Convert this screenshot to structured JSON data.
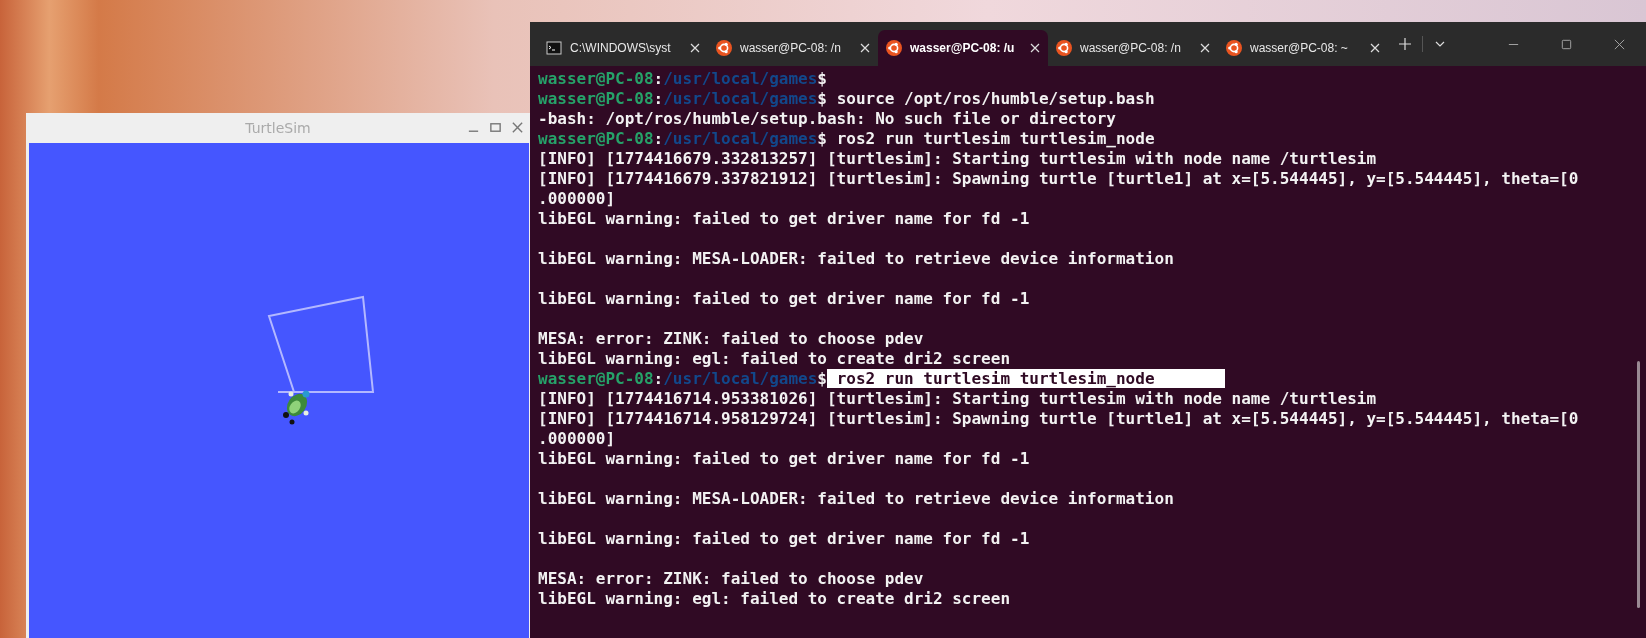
{
  "turtlesim_window": {
    "title": "TurtleSim"
  },
  "terminal": {
    "tabs": [
      {
        "kind": "cmd",
        "label": "C:\\WINDOWS\\syst",
        "selected": false
      },
      {
        "kind": "ubuntu",
        "label": "wasser@PC-08: /n",
        "selected": false
      },
      {
        "kind": "ubuntu",
        "label": "wasser@PC-08: /u",
        "selected": true
      },
      {
        "kind": "ubuntu",
        "label": "wasser@PC-08: /n",
        "selected": false
      },
      {
        "kind": "ubuntu",
        "label": "wasser@PC-08: ~",
        "selected": false
      }
    ],
    "lines": [
      {
        "kind": "prompt",
        "user": "wasser@PC-08",
        "sep": ":",
        "path": "/usr/local/games",
        "end": "$"
      },
      {
        "kind": "prompt",
        "user": "wasser@PC-08",
        "sep": ":",
        "path": "/usr/local/games",
        "end": "$",
        "command": " source /opt/ros/humble/setup.bash",
        "selected": false
      },
      {
        "kind": "output",
        "text": "-bash: /opt/ros/humble/setup.bash: No such file or directory"
      },
      {
        "kind": "prompt",
        "user": "wasser@PC-08",
        "sep": ":",
        "path": "/usr/local/games",
        "end": "$",
        "command": " ros2 run turtlesim turtlesim_node",
        "selected": false
      },
      {
        "kind": "output",
        "text": "[INFO] [1774416679.332813257] [turtlesim]: Starting turtlesim with node name /turtlesim"
      },
      {
        "kind": "output",
        "text": "[INFO] [1774416679.337821912] [turtlesim]: Spawning turtle [turtle1] at x=[5.544445], y=[5.544445], theta=[0"
      },
      {
        "kind": "output",
        "text": ".000000]"
      },
      {
        "kind": "output",
        "text": "libEGL warning: failed to get driver name for fd -1"
      },
      {
        "kind": "blank"
      },
      {
        "kind": "output",
        "text": "libEGL warning: MESA-LOADER: failed to retrieve device information"
      },
      {
        "kind": "blank"
      },
      {
        "kind": "output",
        "text": "libEGL warning: failed to get driver name for fd -1"
      },
      {
        "kind": "blank"
      },
      {
        "kind": "output",
        "text": "MESA: error: ZINK: failed to choose pdev"
      },
      {
        "kind": "output",
        "text": "libEGL warning: egl: failed to create dri2 screen"
      },
      {
        "kind": "prompt",
        "user": "wasser@PC-08",
        "sep": ":",
        "path": "/usr/local/games",
        "end": "$",
        "command": " ros2 run turtlesim turtlesim_node",
        "selected": true
      },
      {
        "kind": "output",
        "text": "[INFO] [1774416714.953381026] [turtlesim]: Starting turtlesim with node name /turtlesim"
      },
      {
        "kind": "output",
        "text": "[INFO] [1774416714.958129724] [turtlesim]: Spawning turtle [turtle1] at x=[5.544445], y=[5.544445], theta=[0"
      },
      {
        "kind": "output",
        "text": ".000000]"
      },
      {
        "kind": "output",
        "text": "libEGL warning: failed to get driver name for fd -1"
      },
      {
        "kind": "blank"
      },
      {
        "kind": "output",
        "text": "libEGL warning: MESA-LOADER: failed to retrieve device information"
      },
      {
        "kind": "blank"
      },
      {
        "kind": "output",
        "text": "libEGL warning: failed to get driver name for fd -1"
      },
      {
        "kind": "blank"
      },
      {
        "kind": "output",
        "text": "MESA: error: ZINK: failed to choose pdev"
      },
      {
        "kind": "output",
        "text": "libEGL warning: egl: failed to create dri2 screen"
      }
    ]
  }
}
